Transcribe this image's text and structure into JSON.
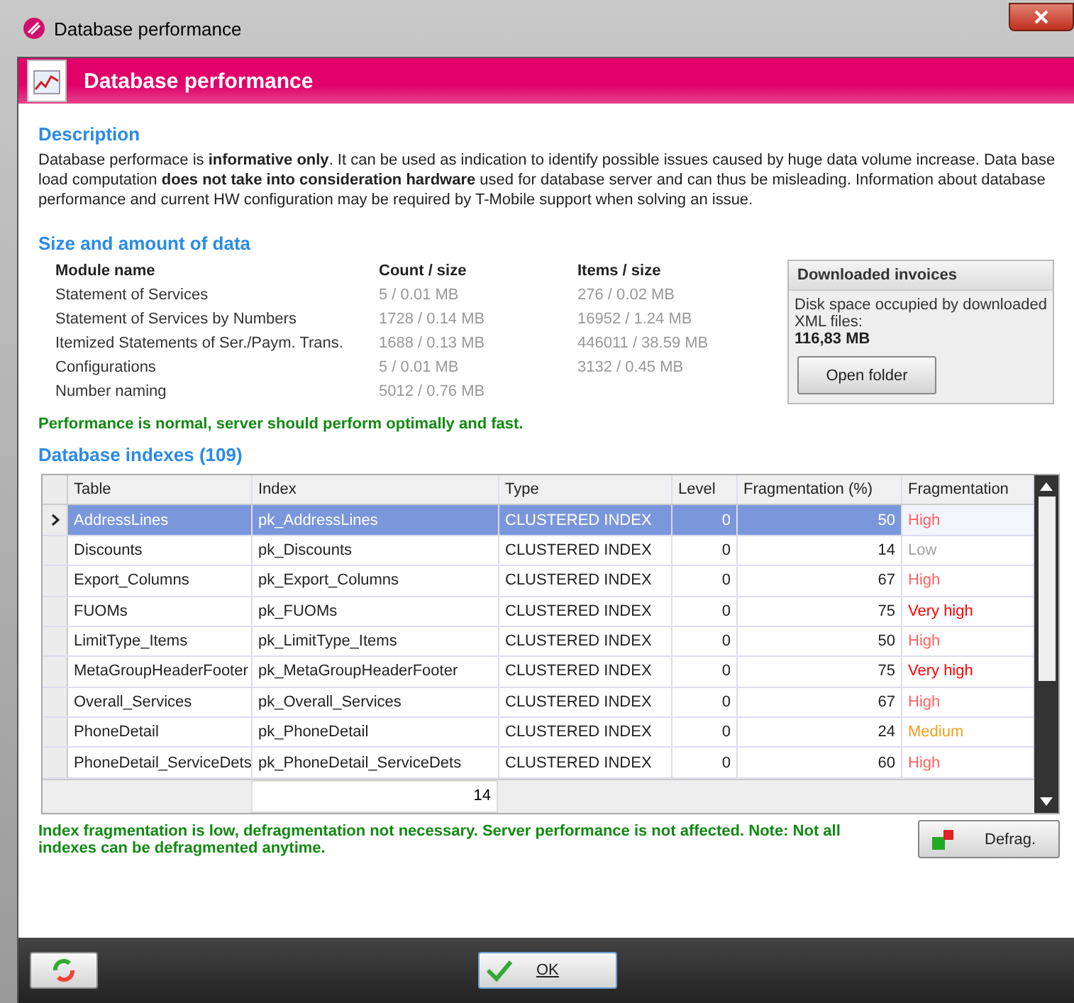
{
  "window": {
    "title": "Database performance"
  },
  "header": {
    "title": "Database performance"
  },
  "description": {
    "heading": "Description",
    "text": "Database performace is **informative only**. It can be used as indication to identify possible issues caused by huge data volume increase. Data base load computation **does not take into consideration hardware** used for database server and can thus be misleading. Information about database performance and current HW configuration may be required by T-Mobile support when solving an issue."
  },
  "size": {
    "heading": "Size and amount of data",
    "columns": [
      "Module name",
      "Count / size",
      "Items / size"
    ],
    "rows": [
      {
        "name": "Statement of Services",
        "count": "5 / 0.01 MB",
        "items": "276 / 0.02 MB"
      },
      {
        "name": "Statement of Services by Numbers",
        "count": "1728 / 0.14 MB",
        "items": "16952 / 1.24 MB"
      },
      {
        "name": "Itemized Statements of Ser./Paym. Trans.",
        "count": "1688 / 0.13 MB",
        "items": "446011 / 38.59 MB"
      },
      {
        "name": "Configurations",
        "count": "5 / 0.01 MB",
        "items": "3132 / 0.45 MB"
      },
      {
        "name": "Number naming",
        "count": "5012 / 0.76 MB"
      }
    ],
    "status": "Performance is normal, server should perform optimally and fast."
  },
  "downloaded": {
    "title": "Downloaded invoices",
    "text": "Disk space occupied by downloaded XML files:",
    "value": "116,83 MB",
    "button": "Open folder"
  },
  "indexes": {
    "heading": "Database indexes (109)",
    "columns": [
      "Table",
      "Index",
      "Type",
      "Level",
      "Fragmentation (%)",
      "Fragmentation"
    ],
    "rows": [
      {
        "table": "AddressLines",
        "index": "pk_AddressLines",
        "type": "CLUSTERED INDEX",
        "level": "0",
        "percent": "50",
        "fragmentation": "High",
        "color": "#ff6060",
        "selected": true
      },
      {
        "table": "Discounts",
        "index": "pk_Discounts",
        "type": "CLUSTERED INDEX",
        "level": "0",
        "percent": "14",
        "fragmentation": "Low",
        "color": "#a0a0a0",
        "selected": false
      },
      {
        "table": "Export_Columns",
        "index": "pk_Export_Columns",
        "type": "CLUSTERED INDEX",
        "level": "0",
        "percent": "67",
        "fragmentation": "High",
        "color": "#ff6060",
        "selected": false
      },
      {
        "table": "FUOMs",
        "index": "pk_FUOMs",
        "type": "CLUSTERED INDEX",
        "level": "0",
        "percent": "75",
        "fragmentation": "Very high",
        "color": "#ff0000",
        "selected": false
      },
      {
        "table": "LimitType_Items",
        "index": "pk_LimitType_Items",
        "type": "CLUSTERED INDEX",
        "level": "0",
        "percent": "50",
        "fragmentation": "High",
        "color": "#ff6060",
        "selected": false
      },
      {
        "table": "MetaGroupHeaderFooter",
        "index": "pk_MetaGroupHeaderFooter",
        "type": "CLUSTERED INDEX",
        "level": "0",
        "percent": "75",
        "fragmentation": "Very high",
        "color": "#ff0000",
        "selected": false
      },
      {
        "table": "Overall_Services",
        "index": "pk_Overall_Services",
        "type": "CLUSTERED INDEX",
        "level": "0",
        "percent": "67",
        "fragmentation": "High",
        "color": "#ff6060",
        "selected": false
      },
      {
        "table": "PhoneDetail",
        "index": "pk_PhoneDetail",
        "type": "CLUSTERED INDEX",
        "level": "0",
        "percent": "24",
        "fragmentation": "Medium",
        "color": "#f0a020",
        "selected": false
      },
      {
        "table": "PhoneDetail_ServiceDets",
        "index": "pk_PhoneDetail_ServiceDets",
        "type": "CLUSTERED INDEX",
        "level": "0",
        "percent": "60",
        "fragmentation": "High",
        "color": "#ff6060",
        "selected": false
      }
    ],
    "summary": "14",
    "status": "Index fragmentation is low, defragmentation not necessary. Server performance is not affected. Note: Not all indexes can be defragmented anytime.",
    "button": "Defrag."
  },
  "footer": {
    "ok": "OK"
  }
}
